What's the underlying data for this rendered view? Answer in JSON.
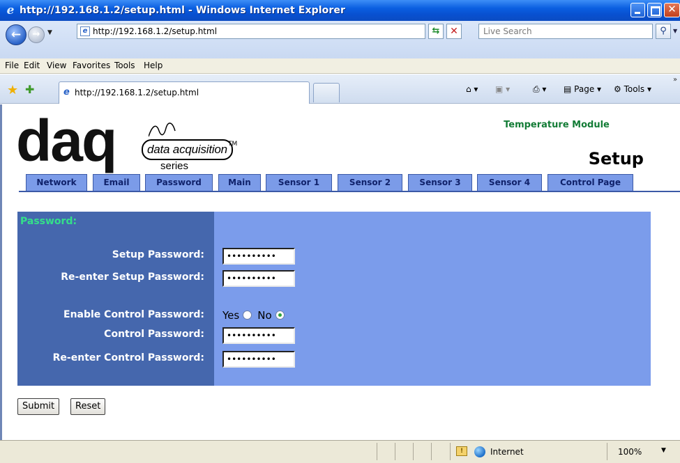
{
  "window": {
    "title": "http://192.168.1.2/setup.html - Windows Internet Explorer"
  },
  "toolbar": {
    "address": "http://192.168.1.2/setup.html",
    "search_placeholder": "Live Search"
  },
  "menu": [
    "File",
    "Edit",
    "View",
    "Favorites",
    "Tools",
    "Help"
  ],
  "favbar": {
    "tab_title": "http://192.168.1.2/setup.html",
    "page_label": "Page",
    "tools_label": "Tools"
  },
  "page": {
    "logo": {
      "brand": "daq",
      "tagline": "data acquisition",
      "series": "series",
      "tm": "TM"
    },
    "module_title": "Temperature Module",
    "setup_title": "Setup",
    "tabs": [
      "Network",
      "Email",
      "Password",
      "Main",
      "Sensor 1",
      "Sensor 2",
      "Sensor 3",
      "Sensor 4",
      "Control Page"
    ],
    "section_title": "Password:",
    "fields": {
      "setup_password_label": "Setup Password:",
      "setup_password_value": "••••••••••",
      "reenter_setup_label": "Re-enter Setup Password:",
      "reenter_setup_value": "••••••••••",
      "enable_control_label": "Enable Control Password:",
      "yes_label": "Yes",
      "no_label": "No",
      "enable_control_selected": "No",
      "control_password_label": "Control Password:",
      "control_password_value": "••••••••••",
      "reenter_control_label": "Re-enter Control Password:",
      "reenter_control_value": "••••••••••"
    },
    "buttons": {
      "submit": "Submit",
      "reset": "Reset"
    }
  },
  "statusbar": {
    "zone": "Internet",
    "zoom": "100%"
  },
  "colors": {
    "tab_bg": "#7b9be8",
    "panel_bg": "#7b9ceb",
    "label_col_bg": "#4567ad",
    "section_title": "#34e08a",
    "module_title": "#137c36"
  }
}
